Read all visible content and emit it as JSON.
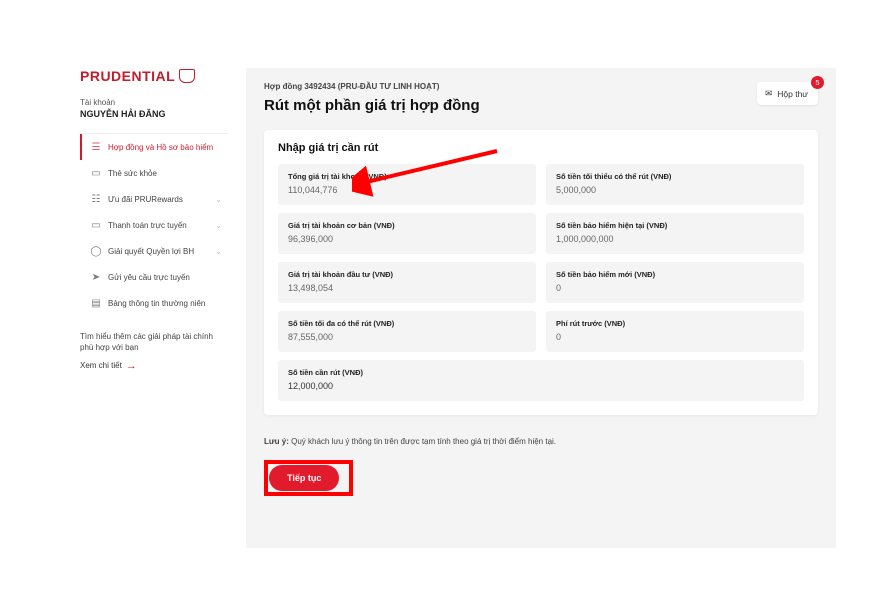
{
  "brand": "PRUDENTIAL",
  "account": {
    "label": "Tài khoản",
    "name": "NGUYỄN HẢI ĐĂNG"
  },
  "nav": [
    {
      "label": "Hợp đồng và Hồ sơ bảo hiểm",
      "active": true,
      "chev": false
    },
    {
      "label": "Thẻ sức khỏe",
      "active": false,
      "chev": false
    },
    {
      "label": "Ưu đãi PRURewards",
      "active": false,
      "chev": true
    },
    {
      "label": "Thanh toán trực tuyến",
      "active": false,
      "chev": true
    },
    {
      "label": "Giải quyết Quyền lợi BH",
      "active": false,
      "chev": true
    },
    {
      "label": "Gửi yêu cầu trực tuyến",
      "active": false,
      "chev": false
    },
    {
      "label": "Bảng thông tin thường niên",
      "active": false,
      "chev": false
    }
  ],
  "help": {
    "text": "Tìm hiểu thêm các giải pháp tài chính phù hợp với bạn",
    "link": "Xem chi tiết"
  },
  "header": {
    "breadcrumb": "Hợp đồng 3492434 (PRU-ĐẦU TƯ LINH HOẠT)",
    "title": "Rút một phần giá trị hợp đồng",
    "mail_label": "Hộp thư",
    "mail_badge": "5"
  },
  "section_title": "Nhập giá trị cần rút",
  "fields": {
    "total_acct": {
      "label": "Tổng giá trị tài khoản (VNĐ)",
      "value": "110,044,776"
    },
    "min_withdraw": {
      "label": "Số tiền tối thiểu có thể rút (VNĐ)",
      "value": "5,000,000"
    },
    "basic_acct": {
      "label": "Giá trị tài khoản cơ bản (VNĐ)",
      "value": "96,396,000"
    },
    "current_insured": {
      "label": "Số tiền bảo hiểm hiện tại (VNĐ)",
      "value": "1,000,000,000"
    },
    "invest_acct": {
      "label": "Giá trị tài khoản đầu tư (VNĐ)",
      "value": "13,498,054"
    },
    "new_insured": {
      "label": "Số tiền bảo hiểm mới (VNĐ)",
      "value": "0"
    },
    "max_withdraw": {
      "label": "Số tiền tối đa có thể rút (VNĐ)",
      "value": "87,555,000"
    },
    "fee": {
      "label": "Phí rút trước (VNĐ)",
      "value": "0"
    },
    "amount": {
      "label": "Số tiền cần rút (VNĐ)",
      "value": "12,000,000"
    }
  },
  "note_prefix": "Lưu ý:",
  "note_body": " Quý khách lưu ý thông tin trên được tạm tính theo giá trị thời điểm hiện tại.",
  "cta_label": "Tiếp tục"
}
